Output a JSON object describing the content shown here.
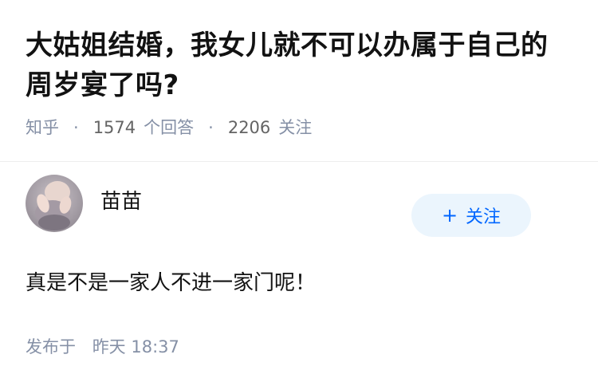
{
  "question": {
    "title": "大姑姐结婚，我女儿就不可以办属于自己的周岁宴了吗?",
    "source": "知乎",
    "answer_count": "1574",
    "answer_label": "个回答",
    "follower_count": "2206",
    "follower_label": "关注",
    "separator": "·"
  },
  "answer": {
    "author_name": "苗苗",
    "follow_button_plus": "+",
    "follow_button_label": "关注",
    "content": "真是不是一家人不进一家门呢！",
    "published_prefix": "发布于",
    "published_day": "昨天",
    "published_time": "18:37"
  },
  "colors": {
    "title": "#121212",
    "meta": "#8590a6",
    "accent": "#0066ff",
    "follow_bg": "#ebf5fd"
  }
}
